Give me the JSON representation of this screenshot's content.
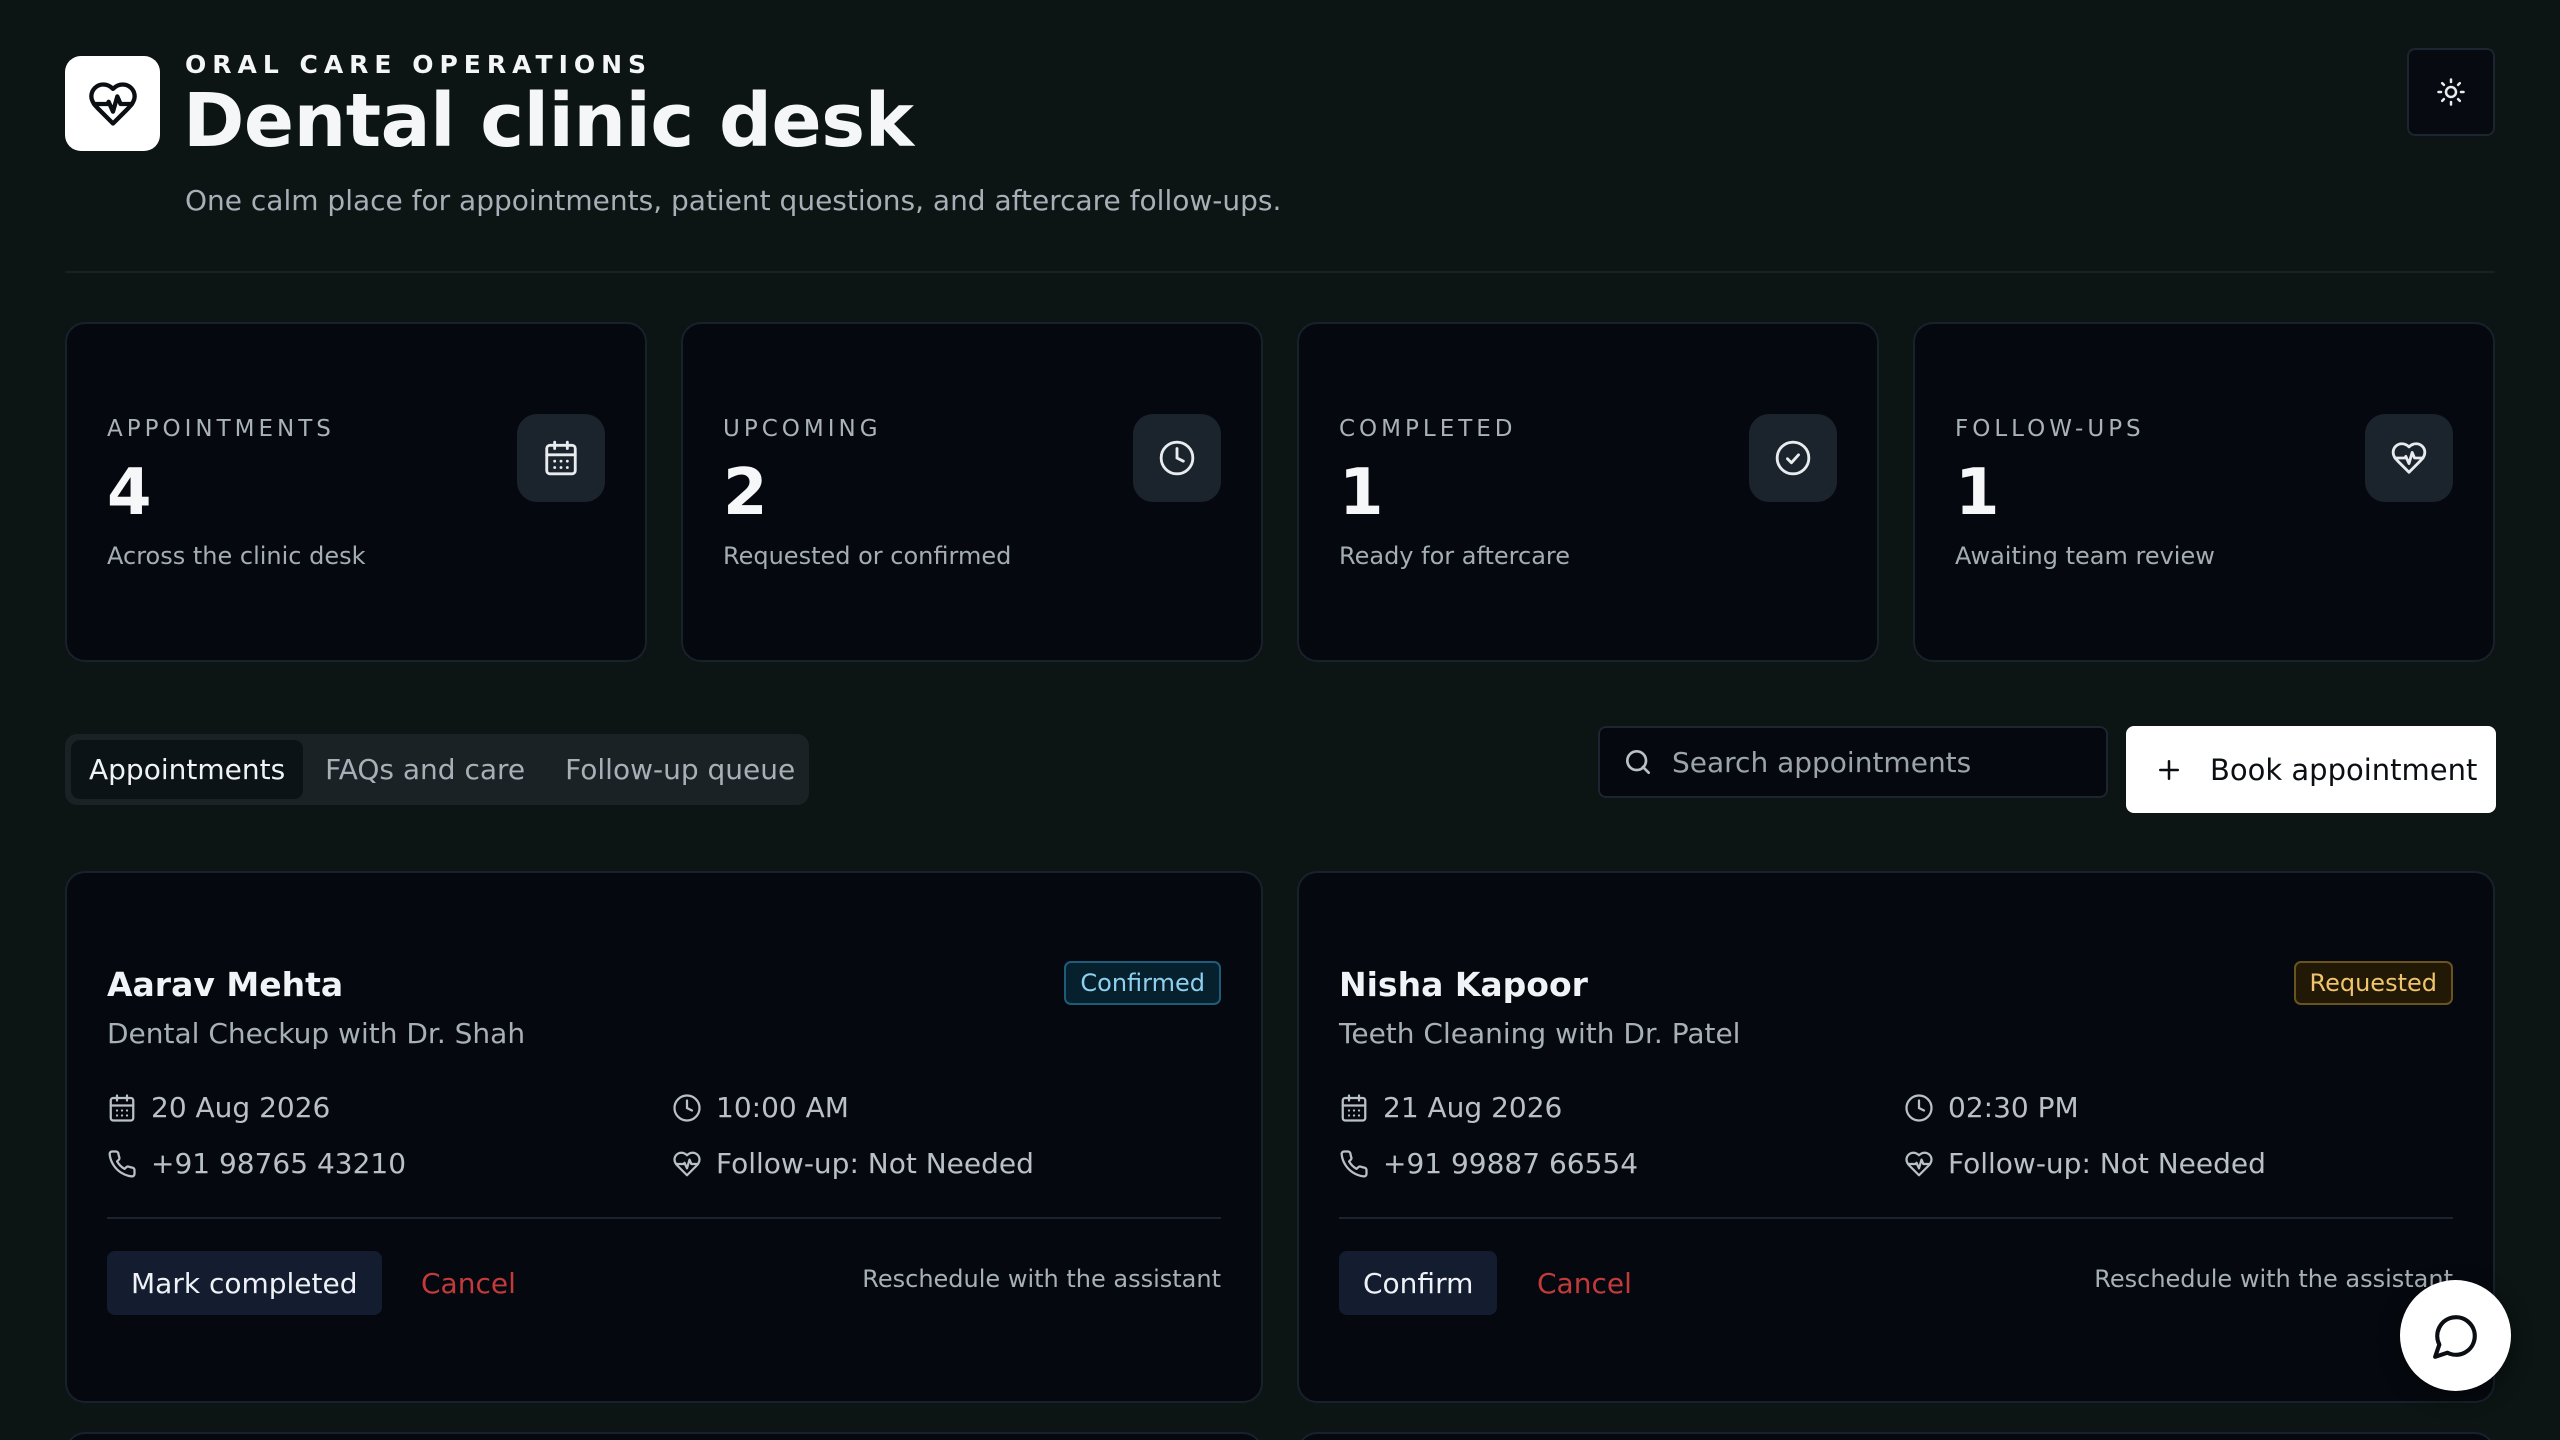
{
  "header": {
    "eyebrow": "ORAL CARE OPERATIONS",
    "title": "Dental clinic desk",
    "subtitle": "One calm place for appointments, patient questions, and aftercare follow-ups.",
    "logo_icon": "heart-pulse-icon",
    "theme_icon": "sun-icon"
  },
  "stats": [
    {
      "label": "APPOINTMENTS",
      "value": "4",
      "desc": "Across the clinic desk",
      "icon": "calendar-icon"
    },
    {
      "label": "UPCOMING",
      "value": "2",
      "desc": "Requested or confirmed",
      "icon": "clock-icon"
    },
    {
      "label": "COMPLETED",
      "value": "1",
      "desc": "Ready for aftercare",
      "icon": "check-circle-icon"
    },
    {
      "label": "FOLLOW-UPS",
      "value": "1",
      "desc": "Awaiting team review",
      "icon": "heart-pulse-icon"
    }
  ],
  "tabs": [
    {
      "label": "Appointments",
      "active": true
    },
    {
      "label": "FAQs and care",
      "active": false
    },
    {
      "label": "Follow-up queue",
      "active": false
    }
  ],
  "search": {
    "placeholder": "Search appointments",
    "value": ""
  },
  "book_button": {
    "label": "Book appointment",
    "icon": "plus-icon"
  },
  "appointments": [
    {
      "patient": "Aarav Mehta",
      "service": "Dental Checkup with Dr. Shah",
      "status": "Confirmed",
      "date": "20 Aug 2026",
      "time": "10:00 AM",
      "phone": "+91 98765 43210",
      "followup": "Follow-up: Not Needed",
      "primary_action": "Mark completed",
      "cancel": "Cancel",
      "reschedule": "Reschedule with the assistant"
    },
    {
      "patient": "Nisha Kapoor",
      "service": "Teeth Cleaning with Dr. Patel",
      "status": "Requested",
      "date": "21 Aug 2026",
      "time": "02:30 PM",
      "phone": "+91 99887 66554",
      "followup": "Follow-up: Not Needed",
      "primary_action": "Confirm",
      "cancel": "Cancel",
      "reschedule": "Reschedule with the assistant"
    }
  ],
  "chat": {
    "icon": "message-circle-icon"
  },
  "colors": {
    "background": "#0c1414",
    "card": "#05090f",
    "confirmed": "#8ed0ef",
    "requested": "#f0c46a",
    "danger": "#c23a3a"
  }
}
